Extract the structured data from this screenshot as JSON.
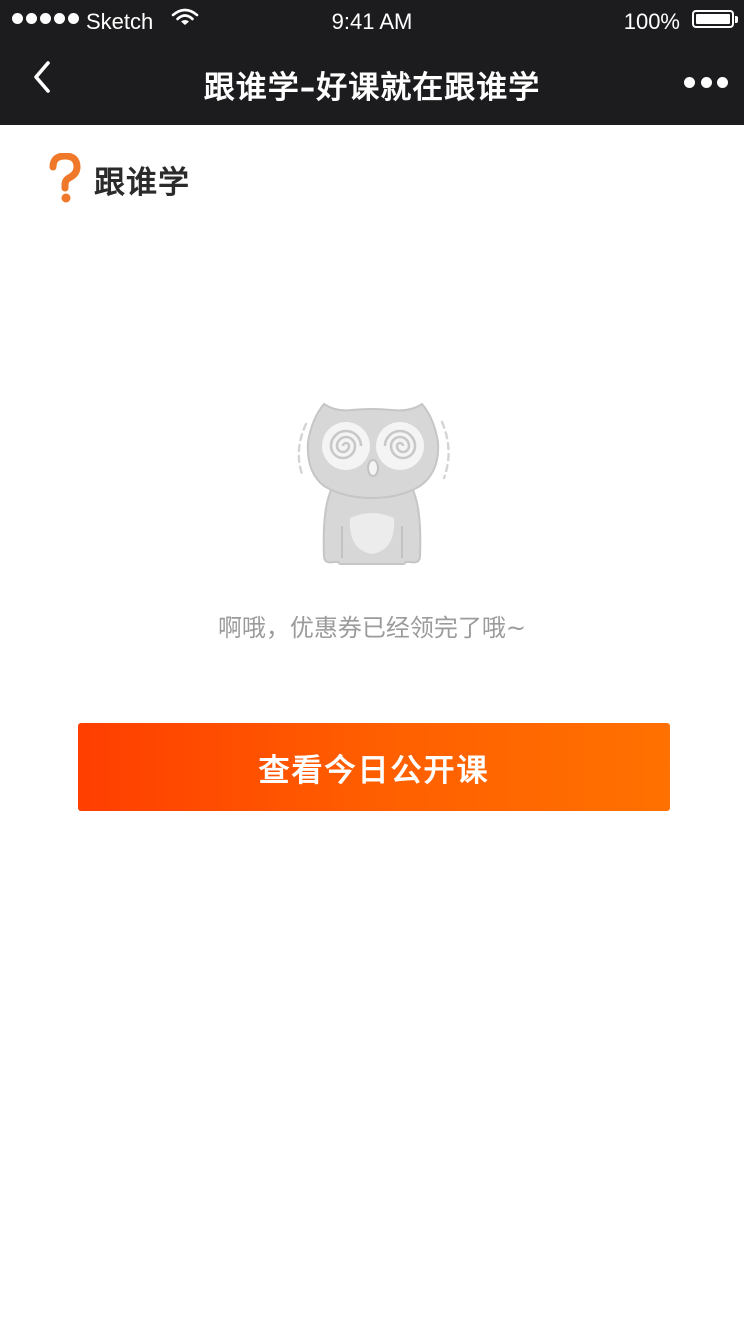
{
  "status_bar": {
    "carrier": "Sketch",
    "time": "9:41 AM",
    "battery": "100%",
    "battery_level": 1.0,
    "signal_icon": "signal-dots-icon",
    "wifi_icon": "wifi-icon",
    "battery_icon": "battery-icon"
  },
  "nav": {
    "title": "跟谁学–好课就在跟谁学",
    "back_icon": "chevron-left-icon",
    "more_icon": "more-dots-icon"
  },
  "brand": {
    "name": "跟谁学",
    "logo_icon": "question-mark-logo-icon",
    "accent_color": "#f0782a"
  },
  "empty_state": {
    "illustration": "dizzy-cat-icon",
    "message": "啊哦，优惠券已经领完了哦~"
  },
  "cta": {
    "label": "查看今日公开课",
    "gradient_start": "#ff3e00",
    "gradient_end": "#ff7100"
  },
  "colors": {
    "header_bg": "#1c1c1e",
    "page_bg": "#ffffff",
    "muted_text": "#9b9b9b"
  }
}
